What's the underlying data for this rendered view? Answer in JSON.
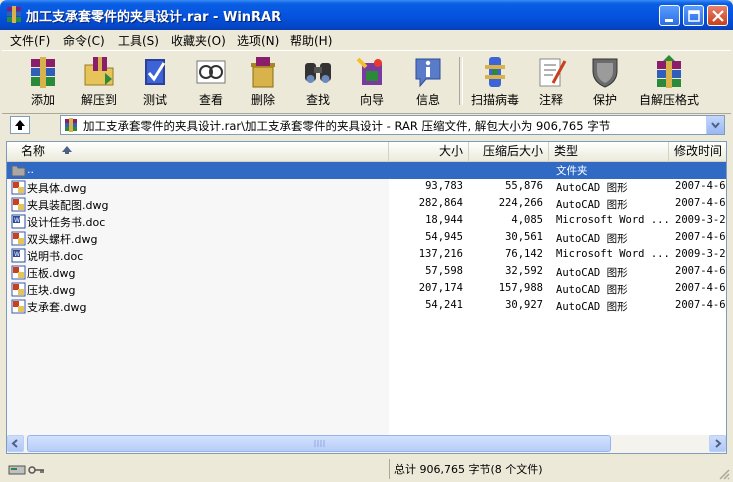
{
  "window": {
    "title": "加工支承套零件的夹具设计.rar - WinRAR"
  },
  "menu": [
    {
      "label": "文件(F)"
    },
    {
      "label": "命令(C)"
    },
    {
      "label": "工具(S)"
    },
    {
      "label": "收藏夹(O)"
    },
    {
      "label": "选项(N)"
    },
    {
      "label": "帮助(H)"
    }
  ],
  "toolbar": [
    {
      "label": "添加",
      "icon": "add-archive-icon"
    },
    {
      "label": "解压到",
      "icon": "extract-to-icon"
    },
    {
      "label": "测试",
      "icon": "test-icon"
    },
    {
      "label": "查看",
      "icon": "view-icon"
    },
    {
      "label": "删除",
      "icon": "delete-icon"
    },
    {
      "label": "查找",
      "icon": "find-icon"
    },
    {
      "label": "向导",
      "icon": "wizard-icon"
    },
    {
      "label": "信息",
      "icon": "info-icon"
    },
    {
      "label": "扫描病毒",
      "icon": "virus-scan-icon"
    },
    {
      "label": "注释",
      "icon": "comment-icon"
    },
    {
      "label": "保护",
      "icon": "protect-icon"
    },
    {
      "label": "自解压格式",
      "icon": "sfx-icon"
    }
  ],
  "address": {
    "path": "加工支承套零件的夹具设计.rar\\加工支承套零件的夹具设计 - RAR 压缩文件, 解包大小为 906,765 字节"
  },
  "columns": {
    "name": "名称",
    "size": "大小",
    "packed": "压缩后大小",
    "type": "类型",
    "modified": "修改时间"
  },
  "files": [
    {
      "name": "..",
      "size": "",
      "packed": "",
      "type": "文件夹",
      "modified": "",
      "kind": "folder"
    },
    {
      "name": "夹具体.dwg",
      "size": "93,783",
      "packed": "55,876",
      "type": "AutoCAD 图形",
      "modified": "2007-4-6",
      "kind": "dwg"
    },
    {
      "name": "夹具装配图.dwg",
      "size": "282,864",
      "packed": "224,266",
      "type": "AutoCAD 图形",
      "modified": "2007-4-6",
      "kind": "dwg"
    },
    {
      "name": "设计任务书.doc",
      "size": "18,944",
      "packed": "4,085",
      "type": "Microsoft Word ...",
      "modified": "2009-3-2",
      "kind": "doc"
    },
    {
      "name": "双头螺杆.dwg",
      "size": "54,945",
      "packed": "30,561",
      "type": "AutoCAD 图形",
      "modified": "2007-4-6",
      "kind": "dwg"
    },
    {
      "name": "说明书.doc",
      "size": "137,216",
      "packed": "76,142",
      "type": "Microsoft Word ...",
      "modified": "2009-3-2",
      "kind": "doc"
    },
    {
      "name": "压板.dwg",
      "size": "57,598",
      "packed": "32,592",
      "type": "AutoCAD 图形",
      "modified": "2007-4-6",
      "kind": "dwg"
    },
    {
      "name": "压块.dwg",
      "size": "207,174",
      "packed": "157,988",
      "type": "AutoCAD 图形",
      "modified": "2007-4-6",
      "kind": "dwg"
    },
    {
      "name": "支承套.dwg",
      "size": "54,241",
      "packed": "30,927",
      "type": "AutoCAD 图形",
      "modified": "2007-4-6",
      "kind": "dwg"
    }
  ],
  "status": {
    "summary": "总计 906,765 字节(8 个文件)"
  }
}
